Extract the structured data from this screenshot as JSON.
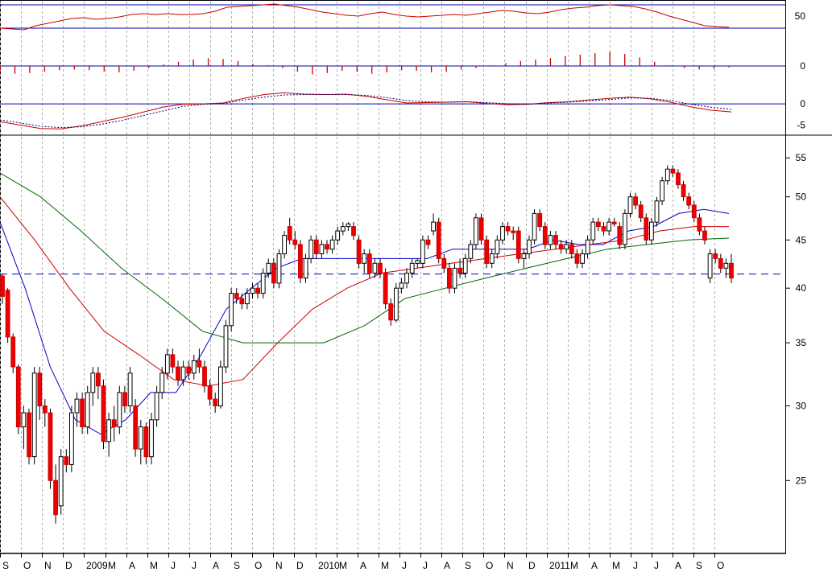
{
  "chart_data": {
    "type": "candlestick",
    "price_axis": {
      "scale": "log",
      "ylim": [
        21,
        57
      ],
      "ticks": [
        "55",
        "50",
        "45",
        "40",
        "35",
        "30",
        "25"
      ],
      "reference_line": 41.4
    },
    "x_axis": {
      "labels": [
        "S",
        "O",
        "N",
        "D",
        "2009",
        "M",
        "A",
        "M",
        "J",
        "J",
        "A",
        "S",
        "O",
        "N",
        "D",
        "2010",
        "M",
        "A",
        "M",
        "J",
        "J",
        "A",
        "S",
        "O",
        "N",
        "D",
        "2011",
        "M",
        "A",
        "M",
        "J",
        "J",
        "A",
        "S",
        "O"
      ]
    },
    "rsi_panel": {
      "ylim": [
        22,
        66
      ],
      "ticks": [
        "50"
      ],
      "upper_line": 64,
      "lower_line": 35,
      "values": [
        35,
        34,
        33,
        38,
        41,
        44,
        47,
        48,
        46,
        47,
        49,
        52,
        53,
        52,
        53,
        52,
        52,
        53,
        56,
        61,
        62,
        63,
        64,
        65,
        63,
        61,
        58,
        55,
        53,
        51,
        50,
        53,
        55,
        52,
        50,
        49,
        50,
        51,
        52,
        51,
        53,
        55,
        57,
        56,
        54,
        53,
        55,
        58,
        60,
        61,
        63,
        64,
        63,
        62,
        59,
        55,
        50,
        46,
        42,
        38,
        37,
        36
      ]
    },
    "histogram_panel": {
      "ylim": [
        -2.5,
        2.5
      ],
      "ticks": [
        "0"
      ],
      "zero_line": 0,
      "values": [
        -0.9,
        -1.1,
        -1.0,
        -0.8,
        -0.6,
        -0.5,
        -0.6,
        -0.8,
        -0.9,
        -0.7,
        -0.3,
        0.2,
        0.6,
        0.9,
        1.1,
        1.0,
        0.7,
        0.3,
        0.1,
        -0.3,
        -0.8,
        -1.2,
        -1.0,
        -0.7,
        -0.8,
        -1.1,
        -0.9,
        -0.6,
        -0.7,
        -0.9,
        -0.8,
        -0.5,
        -0.3,
        0.1,
        0.4,
        0.7,
        0.9,
        1.1,
        1.4,
        1.6,
        1.8,
        2.0,
        1.7,
        1.2,
        0.6,
        0.1,
        -0.3,
        -0.5,
        -0.4,
        -0.2
      ]
    },
    "macd_panel": {
      "ylim": [
        -7,
        4
      ],
      "ticks": [
        "0",
        "-5"
      ],
      "zero_line": 0,
      "series": [
        {
          "color": "#cc0000",
          "values": [
            -4.2,
            -5.0,
            -5.8,
            -5.9,
            -5.2,
            -4.2,
            -3.2,
            -2.0,
            -0.8,
            -0.1,
            0.0,
            0.2,
            1.3,
            2.2,
            2.6,
            2.3,
            2.2,
            2.3,
            1.8,
            1.0,
            0.2,
            0.3,
            0.4,
            0.5,
            0.1,
            -0.2,
            -0.1,
            0.3,
            0.5,
            0.9,
            1.3,
            1.6,
            1.2,
            0.4,
            -0.7,
            -1.5,
            -1.9
          ]
        },
        {
          "color": "#000066",
          "dashed": true,
          "values": [
            -3.8,
            -4.5,
            -5.3,
            -5.6,
            -5.4,
            -4.8,
            -3.9,
            -2.8,
            -1.7,
            -0.6,
            -0.1,
            0.1,
            0.9,
            1.6,
            2.1,
            2.2,
            2.2,
            2.2,
            2.0,
            1.5,
            0.8,
            0.5,
            0.4,
            0.5,
            0.3,
            0.0,
            -0.1,
            0.2,
            0.4,
            0.7,
            1.0,
            1.4,
            1.3,
            0.8,
            -0.1,
            -0.8,
            -1.3
          ]
        }
      ]
    },
    "moving_averages": [
      {
        "color": "#0000cc",
        "values": [
          47,
          40,
          33,
          29,
          28,
          29,
          31,
          31,
          34,
          38,
          40,
          42,
          43,
          43,
          43,
          43,
          43,
          43,
          44,
          44,
          44,
          44,
          45,
          44.5,
          44.5,
          46,
          46.5,
          48,
          48.5,
          48
        ]
      },
      {
        "color": "#cc0000",
        "values": [
          50,
          45,
          40,
          36,
          34,
          32,
          31.5,
          32,
          35,
          38,
          40,
          41.5,
          42,
          42.5,
          43,
          43.5,
          44,
          44.5,
          45,
          46,
          46.5,
          46.5
        ]
      },
      {
        "color": "#006600",
        "values": [
          53,
          50,
          46,
          42,
          39,
          36,
          35,
          35,
          35,
          36.5,
          39,
          40,
          41,
          42,
          43,
          44,
          44.5,
          45,
          45.2
        ]
      }
    ],
    "candles": [
      [
        41.2,
        41.4,
        38.5,
        39.2
      ],
      [
        39.8,
        40.0,
        35.0,
        35.5
      ],
      [
        35.5,
        35.8,
        32.5,
        33.0
      ],
      [
        33.0,
        33.2,
        28.0,
        28.5
      ],
      [
        28.5,
        30.0,
        27.0,
        29.5
      ],
      [
        29.5,
        29.8,
        26.0,
        26.5
      ],
      [
        26.5,
        33.0,
        26.0,
        32.5
      ],
      [
        32.5,
        33.0,
        29.0,
        30.0
      ],
      [
        30.0,
        30.5,
        28.5,
        29.5
      ],
      [
        29.5,
        29.8,
        24.5,
        25.0
      ],
      [
        25.0,
        26.0,
        22.5,
        23.0
      ],
      [
        23.5,
        27.0,
        23.0,
        26.5
      ],
      [
        26.5,
        27.0,
        25.5,
        26.0
      ],
      [
        26.0,
        30.0,
        25.5,
        29.5
      ],
      [
        29.5,
        31.0,
        28.5,
        30.5
      ],
      [
        30.5,
        31.0,
        28.0,
        28.5
      ],
      [
        28.5,
        31.5,
        28.0,
        31.0
      ],
      [
        31.0,
        33.0,
        30.0,
        32.5
      ],
      [
        32.5,
        33.0,
        30.5,
        31.5
      ],
      [
        31.5,
        32.0,
        27.0,
        27.5
      ],
      [
        27.5,
        29.5,
        26.5,
        29.0
      ],
      [
        29.0,
        30.0,
        27.5,
        28.5
      ],
      [
        28.5,
        31.5,
        28.0,
        31.0
      ],
      [
        31.0,
        31.5,
        29.5,
        30.0
      ],
      [
        30.0,
        33.0,
        29.5,
        32.5
      ],
      [
        30.0,
        30.5,
        26.5,
        27.0
      ],
      [
        27.0,
        29.0,
        26.0,
        28.5
      ],
      [
        28.5,
        28.8,
        26.0,
        26.5
      ],
      [
        26.5,
        29.5,
        26.0,
        29.0
      ],
      [
        29.0,
        31.5,
        28.5,
        31.0
      ],
      [
        31.0,
        33.0,
        30.5,
        32.5
      ],
      [
        32.5,
        34.5,
        32.0,
        34.0
      ],
      [
        34.0,
        34.5,
        32.5,
        33.0
      ],
      [
        33.0,
        33.5,
        31.5,
        32.0
      ],
      [
        32.0,
        33.5,
        31.5,
        33.0
      ],
      [
        33.0,
        33.5,
        32.0,
        32.5
      ],
      [
        32.5,
        34.0,
        32.0,
        33.5
      ],
      [
        33.5,
        34.5,
        32.5,
        33.0
      ],
      [
        33.0,
        33.5,
        31.0,
        31.5
      ],
      [
        31.5,
        32.0,
        30.0,
        30.5
      ],
      [
        30.5,
        31.0,
        29.5,
        30.0
      ],
      [
        30.0,
        33.5,
        29.8,
        33.0
      ],
      [
        33.0,
        37.0,
        32.5,
        36.5
      ],
      [
        36.5,
        40.0,
        36.0,
        39.5
      ],
      [
        39.5,
        40.0,
        38.5,
        39.0
      ],
      [
        39.0,
        39.5,
        38.0,
        38.5
      ],
      [
        38.5,
        40.0,
        38.0,
        39.5
      ],
      [
        39.5,
        40.5,
        39.0,
        40.0
      ],
      [
        40.0,
        40.5,
        39.0,
        39.5
      ],
      [
        39.5,
        42.0,
        39.0,
        41.5
      ],
      [
        41.5,
        43.0,
        41.0,
        42.5
      ],
      [
        42.5,
        43.0,
        40.0,
        40.5
      ],
      [
        40.5,
        44.0,
        40.0,
        43.5
      ],
      [
        43.5,
        46.0,
        43.0,
        45.5
      ],
      [
        46.5,
        47.5,
        44.5,
        45.0
      ],
      [
        45.0,
        46.0,
        44.0,
        44.5
      ],
      [
        44.5,
        45.0,
        40.5,
        41.0
      ],
      [
        41.0,
        43.5,
        40.5,
        43.0
      ],
      [
        43.0,
        45.5,
        42.5,
        45.0
      ],
      [
        45.0,
        45.5,
        43.0,
        43.5
      ],
      [
        43.5,
        45.0,
        43.0,
        44.5
      ],
      [
        44.5,
        45.0,
        43.5,
        44.0
      ],
      [
        44.0,
        45.5,
        43.5,
        45.0
      ],
      [
        45.0,
        46.5,
        44.5,
        46.0
      ],
      [
        46.0,
        47.0,
        45.5,
        46.5
      ],
      [
        46.5,
        47.0,
        46.0,
        46.8
      ],
      [
        46.5,
        47.0,
        45.0,
        45.5
      ],
      [
        45.0,
        45.5,
        42.0,
        42.5
      ],
      [
        42.5,
        44.0,
        41.5,
        43.5
      ],
      [
        43.5,
        44.0,
        41.0,
        41.5
      ],
      [
        41.5,
        43.0,
        41.0,
        42.5
      ],
      [
        42.5,
        43.0,
        41.0,
        41.5
      ],
      [
        41.5,
        42.0,
        38.0,
        38.5
      ],
      [
        38.5,
        39.0,
        36.5,
        37.0
      ],
      [
        37.0,
        40.5,
        36.8,
        40.0
      ],
      [
        40.0,
        41.0,
        39.5,
        40.5
      ],
      [
        40.5,
        42.0,
        40.0,
        41.5
      ],
      [
        41.5,
        43.0,
        41.0,
        42.5
      ],
      [
        42.5,
        43.0,
        42.0,
        42.8
      ],
      [
        42.5,
        45.5,
        42.0,
        45.0
      ],
      [
        45.0,
        45.5,
        44.0,
        44.5
      ],
      [
        46.0,
        48.0,
        45.5,
        47.0
      ],
      [
        47.0,
        47.5,
        42.5,
        43.0
      ],
      [
        43.0,
        43.5,
        41.5,
        42.0
      ],
      [
        42.0,
        42.5,
        39.5,
        40.0
      ],
      [
        40.0,
        42.5,
        39.5,
        42.0
      ],
      [
        42.0,
        43.0,
        41.0,
        41.5
      ],
      [
        41.5,
        43.5,
        41.0,
        43.0
      ],
      [
        43.0,
        45.0,
        42.5,
        44.5
      ],
      [
        44.5,
        48.0,
        44.0,
        47.5
      ],
      [
        47.5,
        48.0,
        44.5,
        45.0
      ],
      [
        45.0,
        45.5,
        42.0,
        42.5
      ],
      [
        42.5,
        44.0,
        42.0,
        43.5
      ],
      [
        43.5,
        45.5,
        43.0,
        45.0
      ],
      [
        45.0,
        47.0,
        44.5,
        46.5
      ],
      [
        46.5,
        47.0,
        45.5,
        46.0
      ],
      [
        46.0,
        46.5,
        45.0,
        45.8
      ],
      [
        46.0,
        46.5,
        42.5,
        43.0
      ],
      [
        43.0,
        44.0,
        42.0,
        43.5
      ],
      [
        43.5,
        45.5,
        43.0,
        45.0
      ],
      [
        45.0,
        48.5,
        44.5,
        48.0
      ],
      [
        48.0,
        48.5,
        46.0,
        46.5
      ],
      [
        46.5,
        47.0,
        44.0,
        44.5
      ],
      [
        44.5,
        46.0,
        44.0,
        45.5
      ],
      [
        45.5,
        46.0,
        44.0,
        44.5
      ],
      [
        44.5,
        45.0,
        43.5,
        44.0
      ],
      [
        44.0,
        45.0,
        43.5,
        44.5
      ],
      [
        44.5,
        45.0,
        43.0,
        43.5
      ],
      [
        43.5,
        44.0,
        42.0,
        42.5
      ],
      [
        42.5,
        44.0,
        42.0,
        43.5
      ],
      [
        43.5,
        45.5,
        43.0,
        45.0
      ],
      [
        45.0,
        47.5,
        44.5,
        47.0
      ],
      [
        47.0,
        47.5,
        46.0,
        46.5
      ],
      [
        46.5,
        47.0,
        45.5,
        46.0
      ],
      [
        46.0,
        47.5,
        45.5,
        47.0
      ],
      [
        47.0,
        47.5,
        46.5,
        46.8
      ],
      [
        46.5,
        47.0,
        44.0,
        44.5
      ],
      [
        44.5,
        48.5,
        44.0,
        48.0
      ],
      [
        48.0,
        50.5,
        47.5,
        50.0
      ],
      [
        50.0,
        50.5,
        48.5,
        49.0
      ],
      [
        49.0,
        49.5,
        47.0,
        47.5
      ],
      [
        47.5,
        48.0,
        44.5,
        45.0
      ],
      [
        45.0,
        47.5,
        44.5,
        47.0
      ],
      [
        47.0,
        50.0,
        46.5,
        49.5
      ],
      [
        49.5,
        52.5,
        49.0,
        52.0
      ],
      [
        52.0,
        54.0,
        51.5,
        53.5
      ],
      [
        53.5,
        54.0,
        52.5,
        53.0
      ],
      [
        53.0,
        53.5,
        51.0,
        51.5
      ],
      [
        51.5,
        52.0,
        49.5,
        50.0
      ],
      [
        50.0,
        50.5,
        48.5,
        49.0
      ],
      [
        49.0,
        49.5,
        47.0,
        47.5
      ],
      [
        47.5,
        48.0,
        45.5,
        46.0
      ],
      [
        46.0,
        46.5,
        44.5,
        45.0
      ],
      [
        41.0,
        44.0,
        40.5,
        43.5
      ],
      [
        43.5,
        44.0,
        42.5,
        43.0
      ],
      [
        43.0,
        43.5,
        41.5,
        42.0
      ],
      [
        42.0,
        43.0,
        41.0,
        42.5
      ],
      [
        42.5,
        43.5,
        40.5,
        41.0
      ]
    ]
  }
}
